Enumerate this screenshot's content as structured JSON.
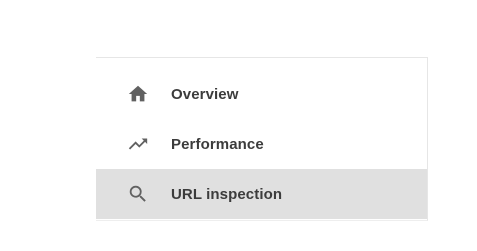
{
  "nav": {
    "items": [
      {
        "label": "Overview",
        "icon": "home-icon",
        "active": false
      },
      {
        "label": "Performance",
        "icon": "trending-up-icon",
        "active": false
      },
      {
        "label": "URL inspection",
        "icon": "search-icon",
        "active": true
      }
    ]
  },
  "colors": {
    "active_background": "#e0e0e0",
    "icon": "#616161",
    "text": "#3c3c3c"
  }
}
